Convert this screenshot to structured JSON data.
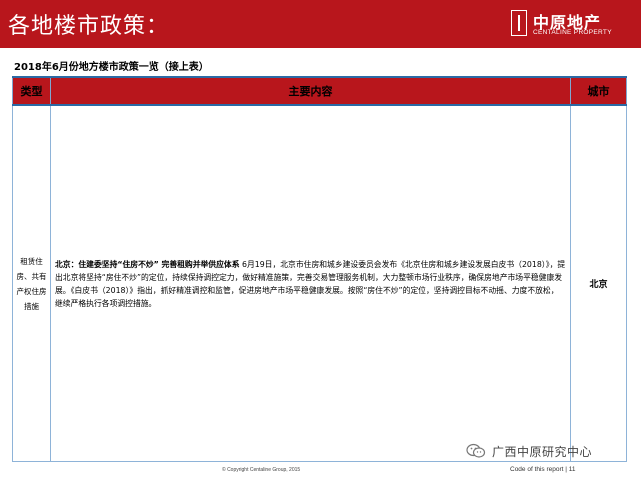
{
  "header": {
    "title": "各地楼市政策：",
    "logo_cn": "中原地产",
    "logo_en": "CENTALINE PROPERTY"
  },
  "subtitle": "2018年6月份地方楼市政策一览（接上表）",
  "table": {
    "headers": [
      "类型",
      "主要内容",
      "城市"
    ],
    "rows": [
      {
        "type": "租赁住房、共有产权住房措施",
        "content_lead": "北京：住建委坚持“住房不炒” 完善租购并举供应体系",
        "content_body": " 6月19日，北京市住房和城乡建设委员会发布《北京住房和城乡建设发展白皮书（2018）》，提出北京将坚持“房住不炒”的定位，持续保持调控定力，做好精准施策，完善交易管理服务机制，大力整顿市场行业秩序，确保房地产市场平稳健康发展。《白皮书（2018）》指出，抓好精准调控和监管，促进房地产市场平稳健康发展。按照“房住不炒”的定位，坚持调控目标不动摇、力度不放松，继续严格执行各项调控措施。",
        "city": "北京"
      }
    ]
  },
  "footer": {
    "copyright": "© Copyright Centaline Group, 2015",
    "page": "Code of this report  |  11"
  },
  "watermark": {
    "icon": "wechat-icon",
    "text": "广西中原研究中心"
  },
  "colors": {
    "brand_red": "#b8161c",
    "table_border": "#8eb3d8"
  }
}
